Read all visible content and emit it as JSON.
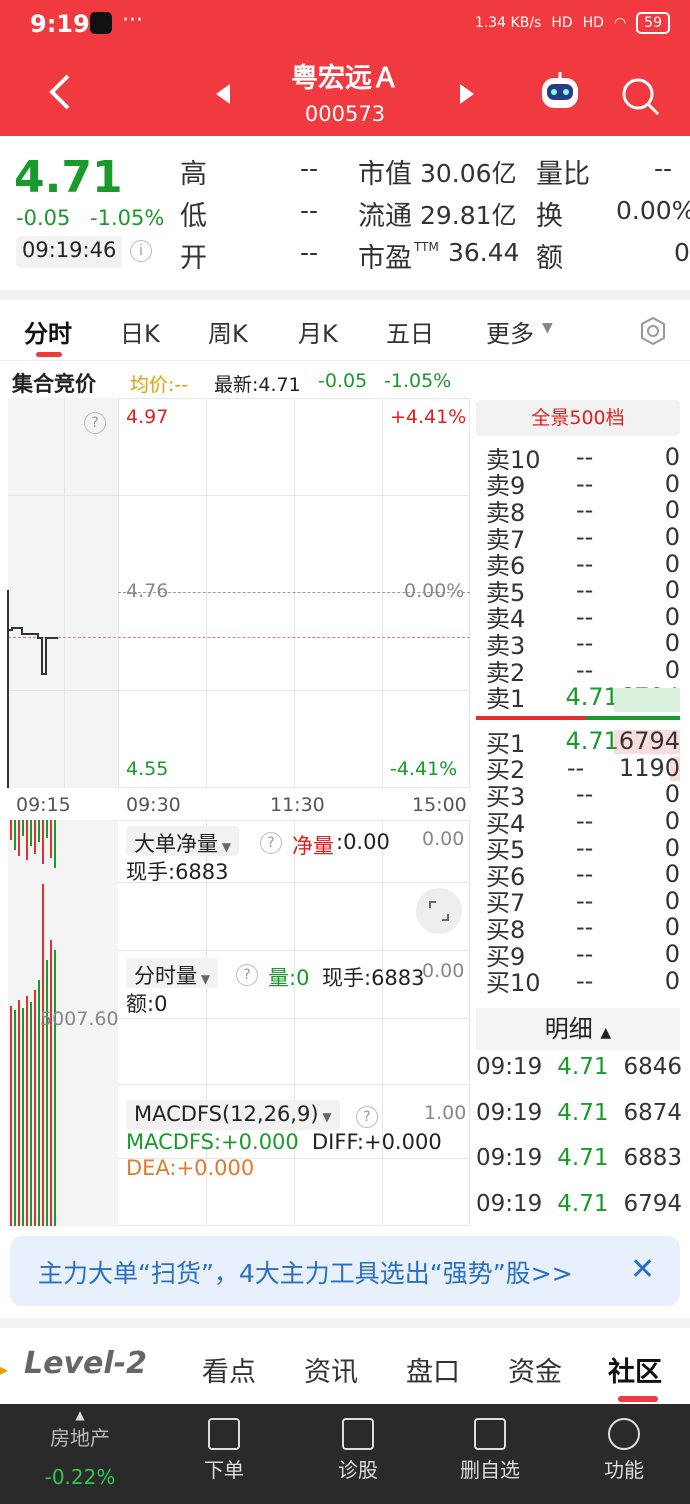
{
  "status": {
    "time": "9:19",
    "net": "1.34 KB/s",
    "signal1": "HD",
    "signal2": "HD",
    "battery": "59"
  },
  "header": {
    "name": "粤宏远Ａ",
    "code": "000573"
  },
  "quote": {
    "price": "4.71",
    "change": "-0.05",
    "pct": "-1.05%",
    "time": "09:19:46",
    "high_label": "高",
    "high": "--",
    "low_label": "低",
    "low": "--",
    "open_label": "开",
    "open": "--",
    "mcap_label": "市值",
    "mcap": "30.06亿",
    "float_label": "流通",
    "float": "29.81亿",
    "pe_label": "市盈",
    "pe_sup": "TTM",
    "pe": "36.44",
    "volratio_label": "量比",
    "volratio": "--",
    "turnover_label": "换",
    "turnover": "0.00%",
    "amount_label": "额",
    "amount": "0"
  },
  "tabs": [
    "分时",
    "日K",
    "周K",
    "月K",
    "五日",
    "更多"
  ],
  "infobar": {
    "title": "集合竞价",
    "avg": "均价:--",
    "latest": "最新:4.71",
    "chg": "-0.05",
    "pct": "-1.05%"
  },
  "chart": {
    "y_top": "4.97",
    "y_mid": "4.76",
    "y_bot": "4.55",
    "pct_top": "+4.41%",
    "pct_mid": "0.00%",
    "pct_bot": "-4.41%",
    "x_labels": [
      "09:15",
      "09:30",
      "11:30",
      "15:00"
    ],
    "left_mid": "5007.60"
  },
  "panels": {
    "p1_title": "大单净量",
    "p1_net_label": "净量",
    "p1_net": ":0.00",
    "p1_right": "0.00",
    "p1_hand": "现手:6883",
    "p2_title": "分时量",
    "p2_vol_label": "量:0",
    "p2_hand": "现手:6883",
    "p2_right": "0.00",
    "p2_amt": "额:0",
    "p3_title": "MACDFS(12,26,9)",
    "p3_right": "1.00",
    "p3_macd": "MACDFS:+0.000",
    "p3_diff": "DIFF:+0.000",
    "p3_dea": "DEA:+0.000"
  },
  "orderbook": {
    "header": "全景500档",
    "asks": [
      {
        "n": "卖10",
        "p": "--",
        "v": "0"
      },
      {
        "n": "卖9",
        "p": "--",
        "v": "0"
      },
      {
        "n": "卖8",
        "p": "--",
        "v": "0"
      },
      {
        "n": "卖7",
        "p": "--",
        "v": "0"
      },
      {
        "n": "卖6",
        "p": "--",
        "v": "0"
      },
      {
        "n": "卖5",
        "p": "--",
        "v": "0"
      },
      {
        "n": "卖4",
        "p": "--",
        "v": "0"
      },
      {
        "n": "卖3",
        "p": "--",
        "v": "0"
      },
      {
        "n": "卖2",
        "p": "--",
        "v": "0"
      },
      {
        "n": "卖1",
        "p": "4.71",
        "v": "6794"
      }
    ],
    "bids": [
      {
        "n": "买1",
        "p": "4.71",
        "v": "6794"
      },
      {
        "n": "买2",
        "p": "--",
        "v": "1190"
      },
      {
        "n": "买3",
        "p": "--",
        "v": "0"
      },
      {
        "n": "买4",
        "p": "--",
        "v": "0"
      },
      {
        "n": "买5",
        "p": "--",
        "v": "0"
      },
      {
        "n": "买6",
        "p": "--",
        "v": "0"
      },
      {
        "n": "买7",
        "p": "--",
        "v": "0"
      },
      {
        "n": "买8",
        "p": "--",
        "v": "0"
      },
      {
        "n": "买9",
        "p": "--",
        "v": "0"
      },
      {
        "n": "买10",
        "p": "--",
        "v": "0"
      }
    ]
  },
  "detail": {
    "title": "明细",
    "rows": [
      {
        "t": "09:19",
        "p": "4.71",
        "v": "6846"
      },
      {
        "t": "09:19",
        "p": "4.71",
        "v": "6874"
      },
      {
        "t": "09:19",
        "p": "4.71",
        "v": "6883"
      },
      {
        "t": "09:19",
        "p": "4.71",
        "v": "6794"
      }
    ]
  },
  "banner": {
    "text": "主力大单“扫货”，4大主力工具选出“强势”股>>"
  },
  "bottom_tabs": [
    "Level-2",
    "看点",
    "资讯",
    "盘口",
    "资金",
    "社区"
  ],
  "nav": {
    "sector": "房地产",
    "sector_pct": "-0.22%",
    "items": [
      "下单",
      "诊股",
      "删自选",
      "功能"
    ]
  }
}
